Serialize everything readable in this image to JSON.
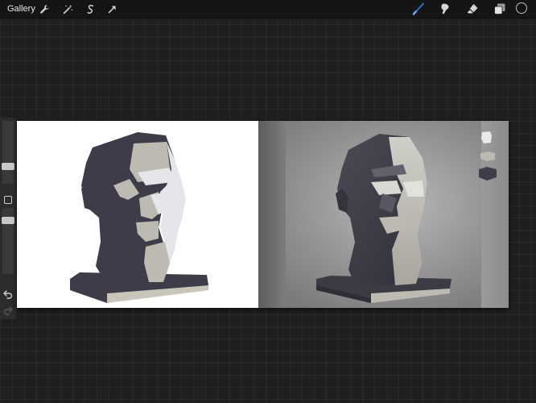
{
  "topbar": {
    "gallery_label": "Gallery",
    "left_tools": [
      "wrench-icon",
      "magic-wand-icon",
      "selection-icon",
      "transform-arrow-icon"
    ],
    "right_tools": [
      "brush-icon",
      "smudge-icon",
      "eraser-icon",
      "layers-icon"
    ],
    "active_tool": "brush-icon",
    "active_color": "#2a6fd6",
    "current_color": "#151515"
  },
  "sidebar": {
    "brush_size_level": 0.25,
    "opacity_level": 0.85
  },
  "canvas": {
    "palette_swatches": [
      "#e9e9e9",
      "#bdbab2",
      "#3f3f4a"
    ],
    "colors": {
      "dark": "#3d3c48",
      "mid": "#bdbab2",
      "light": "#e6e6ea",
      "base_light": "#c9c5b8"
    }
  }
}
